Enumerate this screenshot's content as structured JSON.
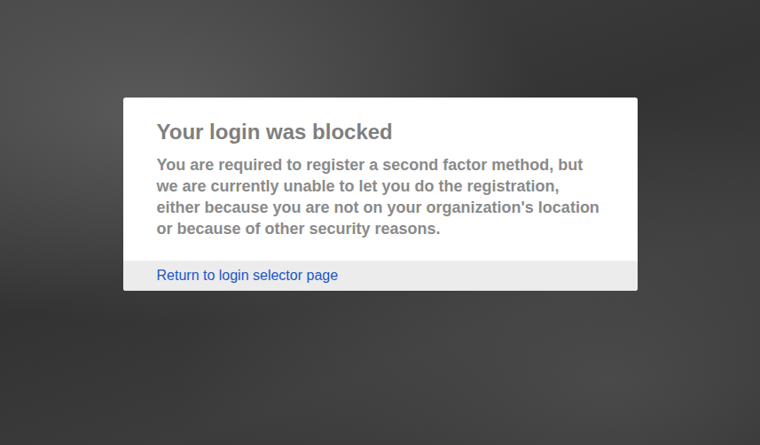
{
  "dialog": {
    "title": "Your login was blocked",
    "message": "You are required to register a second factor method, but we are currently unable to let you do the registration, either because you are not on your organization's location or because of other security reasons.",
    "link": "Return to login selector page"
  }
}
